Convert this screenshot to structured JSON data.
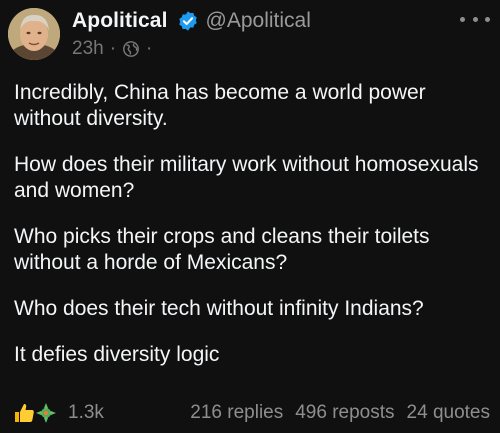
{
  "post": {
    "author_name": "Apolitical",
    "handle": "@Apolitical",
    "time": "23h",
    "separator": "·",
    "paragraphs": [
      "Incredibly, China has become a world power without diversity.",
      "How does their military work without homosexuals and women?",
      "Who picks their crops and cleans their toilets without a horde of Mexicans?",
      "Who does their tech without infinity Indians?",
      "It defies diversity logic"
    ],
    "reaction_count": "1.3k",
    "replies": "216 replies",
    "reposts": "496 reposts",
    "quotes": "24 quotes"
  },
  "icons": {
    "verified": "verified-badge-icon",
    "globe": "globe-icon",
    "more": "more-options-icon",
    "like": "thumbs-up-icon",
    "secondary_reaction": "reaction-icon"
  },
  "colors": {
    "background": "#101010",
    "text": "#f3f5f7",
    "muted": "#8e8e8e",
    "verified": "#1d9bf0"
  }
}
